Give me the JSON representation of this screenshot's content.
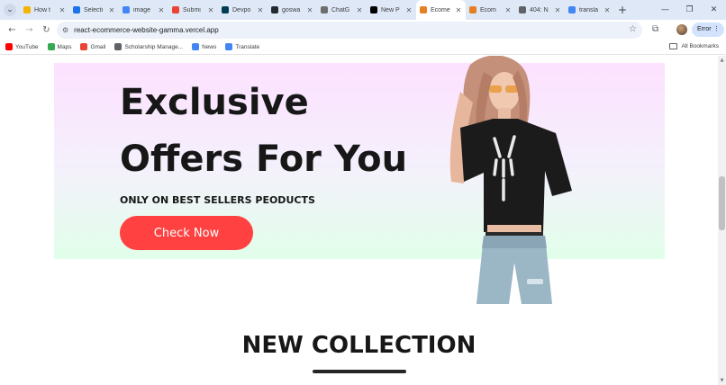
{
  "browser": {
    "tabs": [
      {
        "title": "How t",
        "icon": "bookmark-icon",
        "color": "#f4b400",
        "active": false
      },
      {
        "title": "Selecti",
        "icon": "site-icon",
        "color": "#1a73e8",
        "active": false
      },
      {
        "title": "image",
        "icon": "google-icon",
        "color": "#4285f4",
        "active": false
      },
      {
        "title": "Submi",
        "icon": "gmail-icon",
        "color": "#ea4335",
        "active": false
      },
      {
        "title": "Devpo",
        "icon": "devpost-icon",
        "color": "#003e54",
        "active": false
      },
      {
        "title": "goswa",
        "icon": "github-icon",
        "color": "#24292f",
        "active": false
      },
      {
        "title": "ChatG",
        "icon": "chatgpt-icon",
        "color": "#6e6e6e",
        "active": false
      },
      {
        "title": "New P",
        "icon": "vercel-icon",
        "color": "#000000",
        "active": false
      },
      {
        "title": "Ecome",
        "icon": "vercel-icon",
        "color": "#e67e22",
        "active": true
      },
      {
        "title": "Ecom",
        "icon": "vercel-icon",
        "color": "#e67e22",
        "active": false
      },
      {
        "title": "404: N",
        "icon": "vercel-icon",
        "color": "#5f6368",
        "active": false
      },
      {
        "title": "transla",
        "icon": "google-icon",
        "color": "#4285f4",
        "active": false
      }
    ],
    "new_tab": "+",
    "url": "react-ecommerce-website-gamma.vercel.app",
    "error_label": "Error",
    "bookmarks": [
      {
        "label": "YouTube",
        "color": "#ff0000"
      },
      {
        "label": "Maps",
        "color": "#34a853"
      },
      {
        "label": "Gmail",
        "color": "#ea4335"
      },
      {
        "label": "Scholarship Manage...",
        "color": "#5f6368"
      },
      {
        "label": "News",
        "color": "#4285f4"
      },
      {
        "label": "Translate",
        "color": "#4285f4"
      }
    ],
    "all_bookmarks": "All Bookmarks"
  },
  "hero": {
    "line1": "Exclusive",
    "line2": "Offers For You",
    "subtitle": "ONLY ON BEST SELLERS PEODUCTS",
    "cta": "Check Now",
    "accent": "#ff4141",
    "image": "model-in-black-tshirt"
  },
  "collection": {
    "title": "NEW COLLECTION"
  }
}
